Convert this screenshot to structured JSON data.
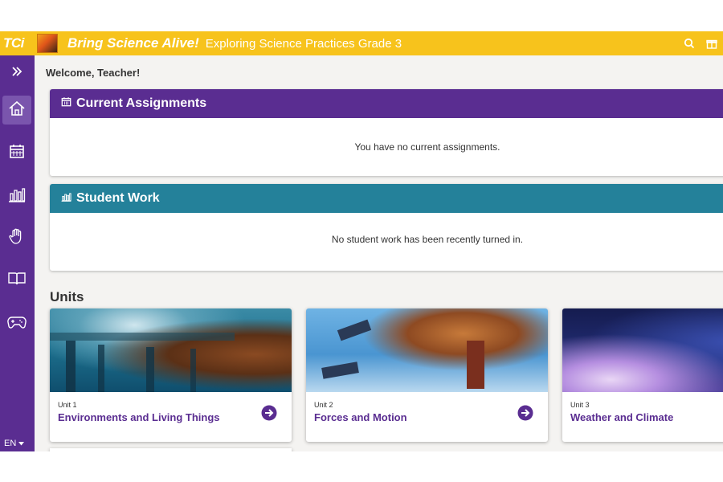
{
  "topbar": {
    "logo": "TCi",
    "brand": "Bring Science Alive!",
    "course_title": "Exploring Science Practices Grade 3"
  },
  "sidebar": {
    "items": [
      {
        "name": "expand",
        "icon": "double-chevron-right-icon"
      },
      {
        "name": "home",
        "icon": "home-icon",
        "active": true
      },
      {
        "name": "calendar",
        "icon": "calendar-icon"
      },
      {
        "name": "reports",
        "icon": "bar-chart-icon"
      },
      {
        "name": "hand",
        "icon": "hand-icon"
      },
      {
        "name": "book",
        "icon": "book-icon"
      },
      {
        "name": "games",
        "icon": "gamepad-icon"
      }
    ],
    "language": "EN"
  },
  "main": {
    "welcome": "Welcome, Teacher!",
    "current_assignments": {
      "title": "Current Assignments",
      "message": "You have no current assignments.",
      "color": "#5a2d91"
    },
    "student_work": {
      "title": "Student Work",
      "message": "No student work has been recently turned in.",
      "color": "#24819a"
    },
    "units_title": "Units",
    "units": [
      {
        "number": "Unit 1",
        "name": "Environments and Living Things"
      },
      {
        "number": "Unit 2",
        "name": "Forces and Motion"
      },
      {
        "number": "Unit 3",
        "name": "Weather and Climate"
      }
    ]
  },
  "colors": {
    "topbar": "#f7c31c",
    "sidebar": "#5a2d91",
    "accent": "#5a2d91"
  }
}
